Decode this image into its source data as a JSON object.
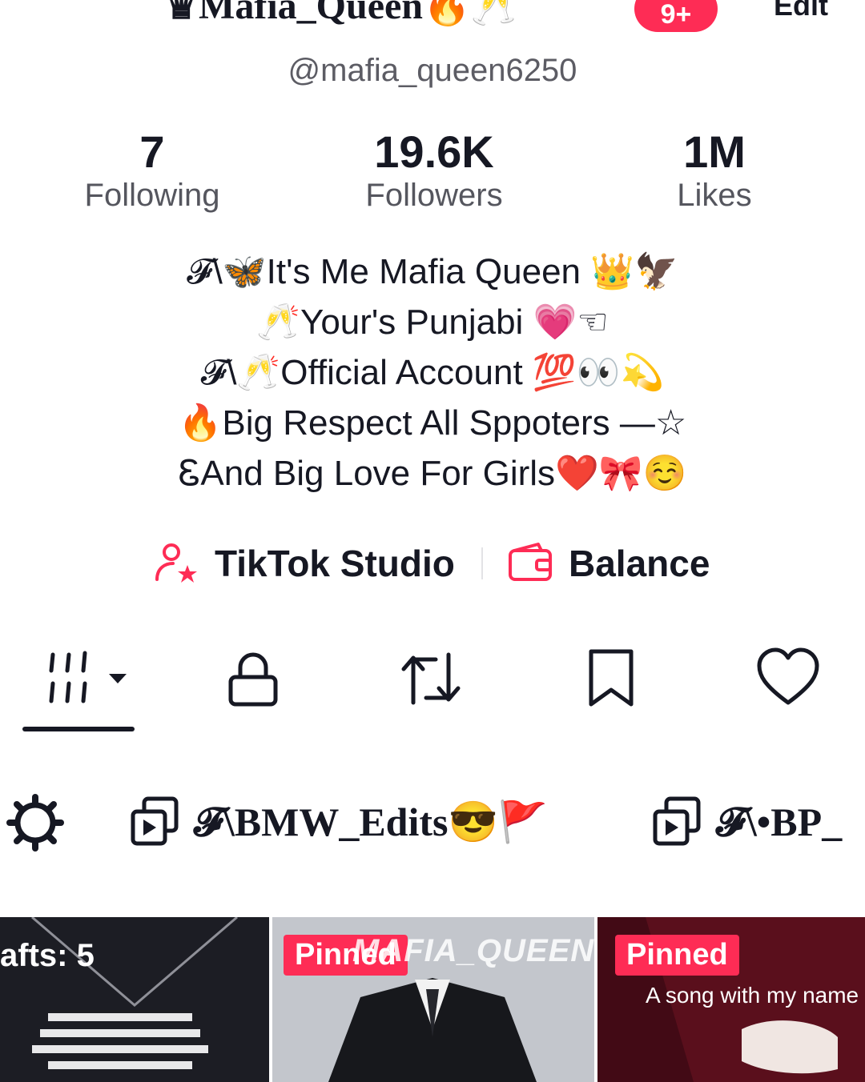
{
  "profile": {
    "display_name": "♛Mafia_Queen🔥🥂",
    "notification_count": "9+",
    "edit_label": "Edit",
    "username": "@mafia_queen6250"
  },
  "stats": [
    {
      "value": "7",
      "label": "Following"
    },
    {
      "value": "19.6K",
      "label": "Followers"
    },
    {
      "value": "1M",
      "label": "Likes"
    }
  ],
  "bio": [
    "𝓕\\🦋It's Me Mafia Queen 👑🦅",
    "🥂Your's Punjabi 💗☜",
    "𝓕\\🥂Official Account 💯👀💫",
    "🔥Big Respect All Sppoters —☆",
    "ᏋAnd Big Love For Girls❤️🎀☺️"
  ],
  "links": {
    "studio_label": "TikTok Studio",
    "balance_label": "Balance"
  },
  "tabs": {
    "icons": [
      "grid-icon",
      "lock-icon",
      "repost-icon",
      "bookmark-icon",
      "heart-icon"
    ],
    "active": "grid-icon"
  },
  "playlists": [
    {
      "name": "𝓕\\BMW_Edits😎🚩"
    },
    {
      "name": "𝓕\\•BP_"
    }
  ],
  "videos": [
    {
      "overlay": "afts: 5"
    },
    {
      "badge": "Pinned",
      "watermark": "MAFIA_QUEEN"
    },
    {
      "badge": "Pinned",
      "caption": "A song with my name"
    }
  ],
  "colors": {
    "accent": "#fe2c55",
    "text_primary": "#161823",
    "text_secondary": "#5c5c64"
  }
}
